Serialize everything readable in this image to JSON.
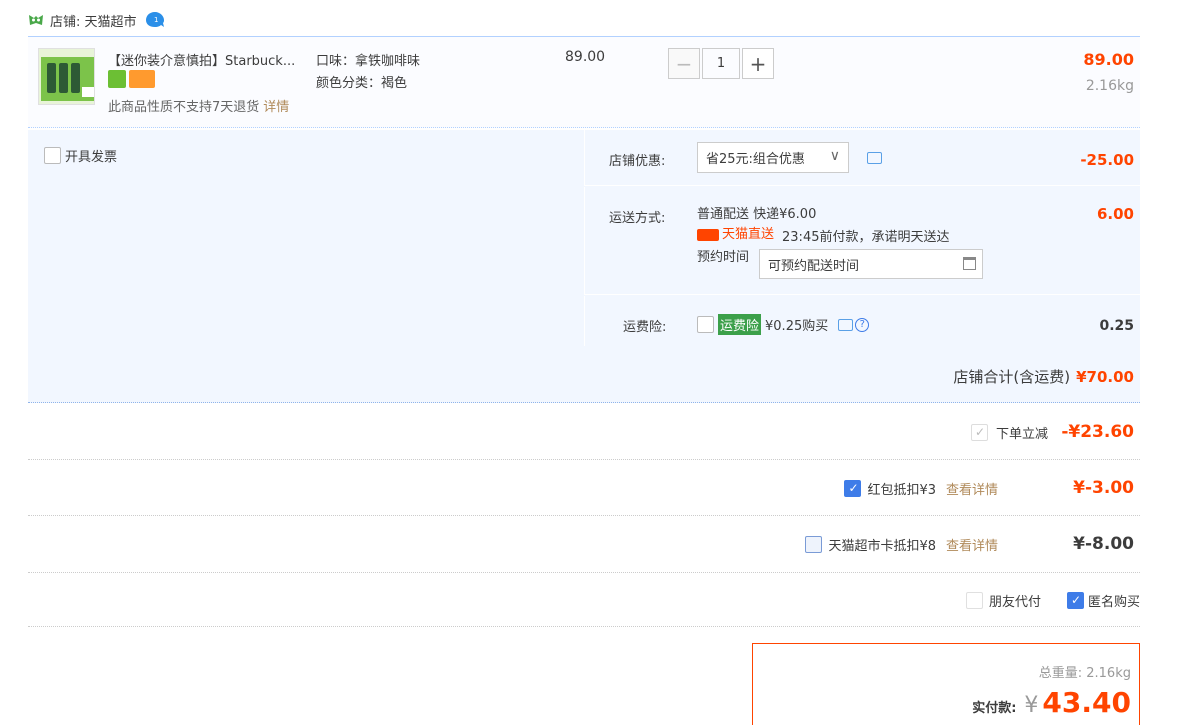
{
  "shop": {
    "name": "店铺: 天猫超市"
  },
  "item": {
    "title": "【迷你装介意慎拍】Starbuck...",
    "return_note": "此商品性质不支持7天退货",
    "return_detail": "详情",
    "flavor": "口味：拿铁咖啡味",
    "color": "颜色分类：褐色",
    "unit_price": "89.00",
    "quantity": "1",
    "total": "89.00",
    "weight": "2.16kg"
  },
  "options": {
    "invoice_label": "开具发票",
    "shop_discount_label": "店铺优惠:",
    "shop_discount_value": "省25元:组合优惠",
    "shop_discount_amount": "-25.00",
    "shipping_label": "运送方式:",
    "shipping_method": "普通配送 快递¥6.00",
    "tmall_direct": "天猫直送",
    "delivery_promise": "23:45前付款，承诺明天送达",
    "reserve_label": "预约时间",
    "reserve_placeholder": "可预约配送时间",
    "shipping_amount": "6.00",
    "insurance_label": "运费险:",
    "insurance_tag": "运费险",
    "insurance_price": "¥0.25购买",
    "insurance_amount": "0.25",
    "shop_total_label": "店铺合计(含运费)",
    "shop_total_amount": "¥70.00"
  },
  "discounts": {
    "instant_label": "下单立减",
    "instant_amount": "-¥23.60",
    "redpacket_label": "红包抵扣¥3",
    "redpacket_detail": "查看详情",
    "redpacket_amount": "¥-3.00",
    "card_label": "天猫超市卡抵扣¥8",
    "card_detail": "查看详情",
    "card_amount": "¥-8.00",
    "friend_pay_label": "朋友代付",
    "anonymous_label": "匿名购买"
  },
  "summary": {
    "weight_text": "总重量: 2.16kg",
    "pay_label": "实付款:",
    "currency": "¥",
    "pay_amount": "43.40"
  },
  "colors": {
    "accent_red": "#ff4400",
    "border_blue": "#b2d1ff",
    "checkbox_blue": "#3e7ce8"
  }
}
